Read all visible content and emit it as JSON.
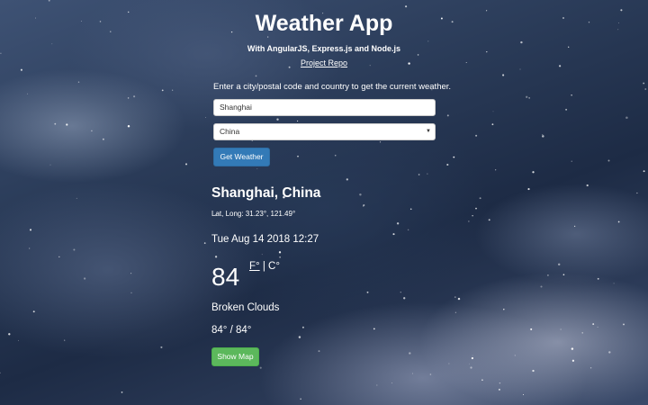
{
  "header": {
    "title": "Weather App",
    "subtitle": "With AngularJS, Express.js and Node.js",
    "repo_link": "Project Repo"
  },
  "form": {
    "instructions": "Enter a city/postal code and country to get the current weather.",
    "city_value": "Shanghai",
    "country_selected": "China",
    "submit_label": "Get Weather"
  },
  "result": {
    "location": "Shanghai, China",
    "coords": "Lat, Long: 31.23°, 121.49°",
    "datetime": "Tue Aug 14 2018 12:27",
    "temperature": "84",
    "unit_f": "F°",
    "unit_separator": "|",
    "unit_c": "C°",
    "condition": "Broken Clouds",
    "range": "84° / 84°",
    "map_button_label": "Show Map"
  },
  "colors": {
    "primary_button": "#337ab7",
    "success_button": "#5cb85c",
    "text": "#ffffff"
  },
  "icons": {
    "select_caret": "caret-down-icon"
  }
}
